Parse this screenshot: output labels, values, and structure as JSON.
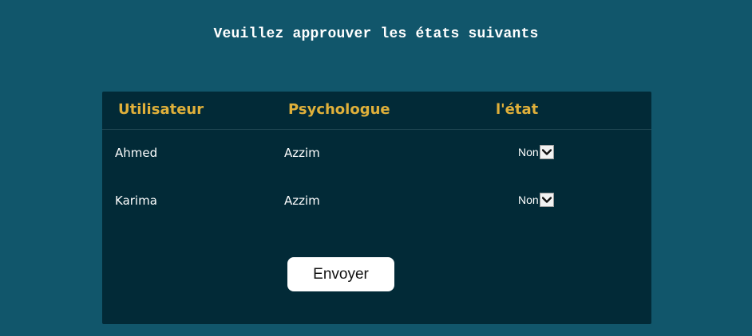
{
  "title": "Veuillez approuver les états suivants",
  "table": {
    "headers": {
      "user": "Utilisateur",
      "psychologist": "Psychologue",
      "state": "l'état"
    },
    "rows": [
      {
        "user": "Ahmed",
        "psychologist": "Azzim",
        "state": "Non"
      },
      {
        "user": "Karima",
        "psychologist": "Azzim",
        "state": "Non"
      }
    ]
  },
  "submit_label": "Envoyer",
  "icons": {
    "select_arrow": "chevron-down-icon"
  },
  "colors": {
    "background": "#11566b",
    "panel": "#022a37",
    "header_text": "#e0b03a",
    "text": "#ffffff"
  }
}
